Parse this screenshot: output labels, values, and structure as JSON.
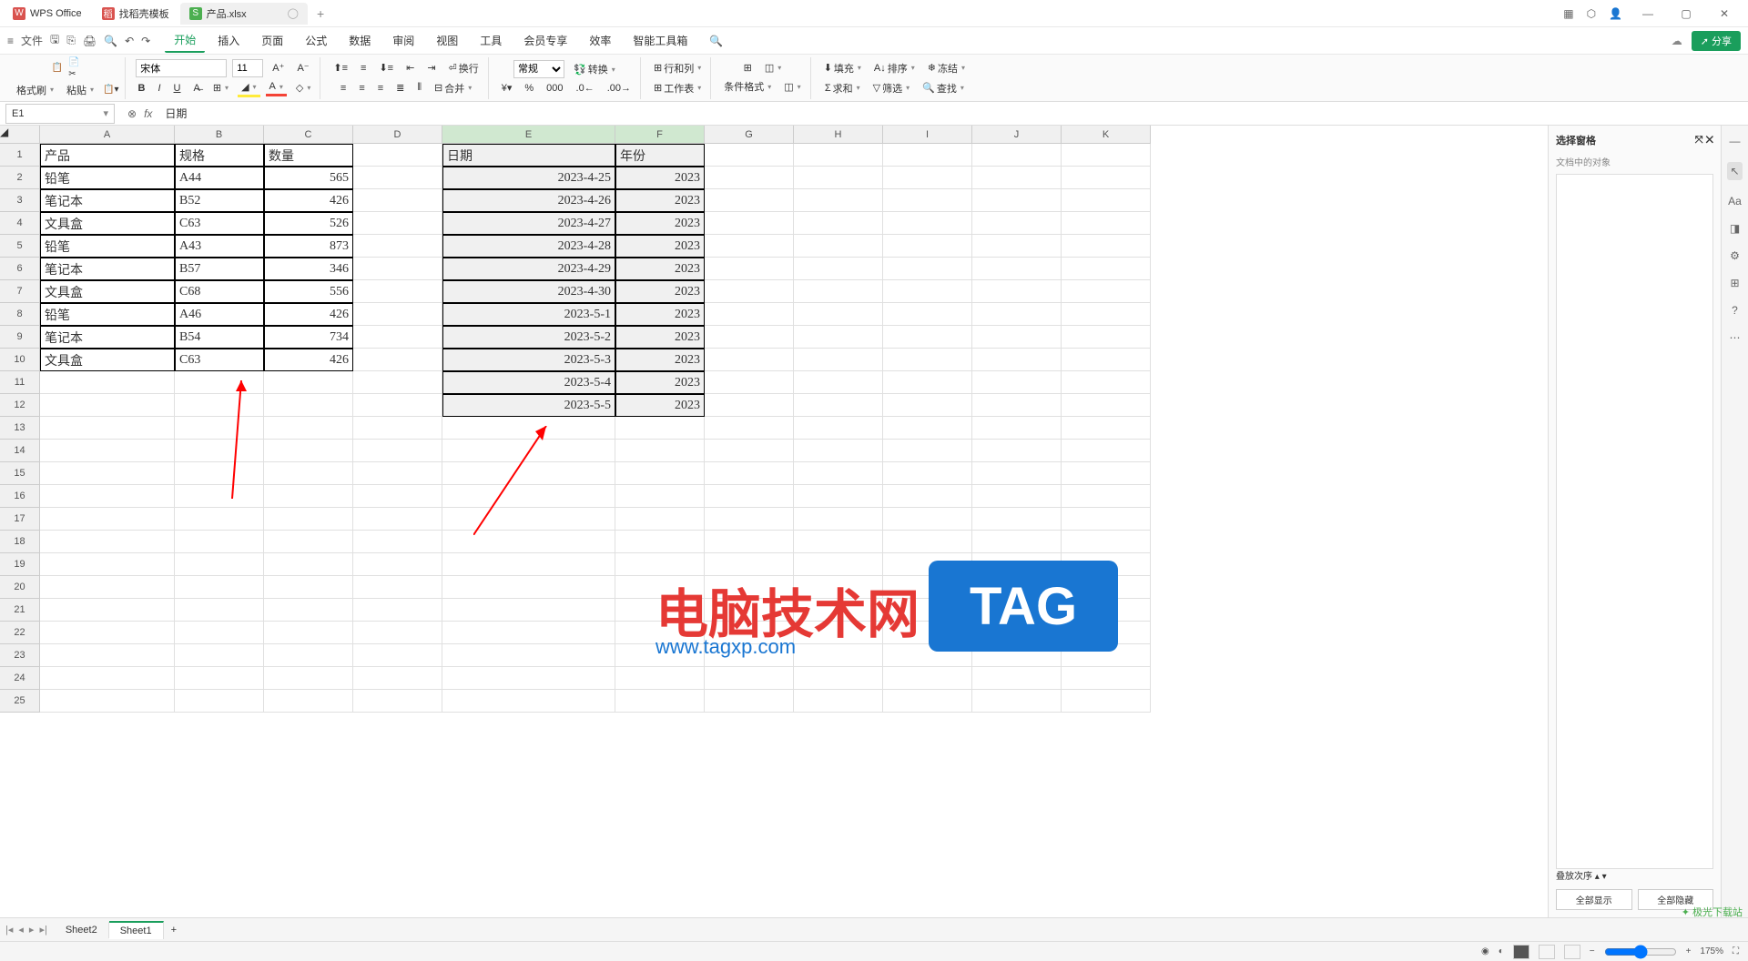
{
  "titlebar": {
    "tabs": [
      {
        "icon": "W",
        "label": "WPS Office"
      },
      {
        "icon": "稻",
        "label": "找稻壳模板"
      },
      {
        "icon": "S",
        "label": "产品.xlsx"
      }
    ],
    "add": "+"
  },
  "qat": {
    "menu": "≡",
    "file": "文件"
  },
  "menus": [
    "开始",
    "插入",
    "页面",
    "公式",
    "数据",
    "审阅",
    "视图",
    "工具",
    "会员专享",
    "效率",
    "智能工具箱"
  ],
  "share": "分享",
  "ribbon": {
    "format_painter": "格式刷",
    "paste": "粘贴",
    "font": "宋体",
    "font_size": "11",
    "number_format": "常规",
    "convert": "转换",
    "rowcol": "行和列",
    "worksheet": "工作表",
    "cond_format": "条件格式",
    "fill": "填充",
    "sort": "排序",
    "freeze": "冻结",
    "find": "求和",
    "filter": "筛选",
    "search": "查找",
    "merge": "合并",
    "wrap": "换行"
  },
  "name_box": "E1",
  "formula": "日期",
  "columns": [
    "A",
    "B",
    "C",
    "D",
    "E",
    "F",
    "G",
    "H",
    "I",
    "J",
    "K"
  ],
  "table1": {
    "headers": [
      "产品",
      "规格",
      "数量"
    ],
    "rows": [
      [
        "铅笔",
        "A44",
        "565"
      ],
      [
        "笔记本",
        "B52",
        "426"
      ],
      [
        "文具盒",
        "C63",
        "526"
      ],
      [
        "铅笔",
        "A43",
        "873"
      ],
      [
        "笔记本",
        "B57",
        "346"
      ],
      [
        "文具盒",
        "C68",
        "556"
      ],
      [
        "铅笔",
        "A46",
        "426"
      ],
      [
        "笔记本",
        "B54",
        "734"
      ],
      [
        "文具盒",
        "C63",
        "426"
      ]
    ]
  },
  "table2": {
    "headers": [
      "日期",
      "年份"
    ],
    "rows": [
      [
        "2023-4-25",
        "2023"
      ],
      [
        "2023-4-26",
        "2023"
      ],
      [
        "2023-4-27",
        "2023"
      ],
      [
        "2023-4-28",
        "2023"
      ],
      [
        "2023-4-29",
        "2023"
      ],
      [
        "2023-4-30",
        "2023"
      ],
      [
        "2023-5-1",
        "2023"
      ],
      [
        "2023-5-2",
        "2023"
      ],
      [
        "2023-5-3",
        "2023"
      ],
      [
        "2023-5-4",
        "2023"
      ],
      [
        "2023-5-5",
        "2023"
      ]
    ]
  },
  "right_panel": {
    "title": "选择窗格",
    "subtitle": "文档中的对象",
    "order": "叠放次序",
    "show_all": "全部显示",
    "hide_all": "全部隐藏"
  },
  "sheets": {
    "s2": "Sheet2",
    "s1": "Sheet1",
    "add": "+"
  },
  "statusbar": {
    "zoom": "175%"
  },
  "watermark": {
    "title": "电脑技术网",
    "url": "www.tagxp.com",
    "tag": "TAG",
    "jg": "极光下载站"
  }
}
